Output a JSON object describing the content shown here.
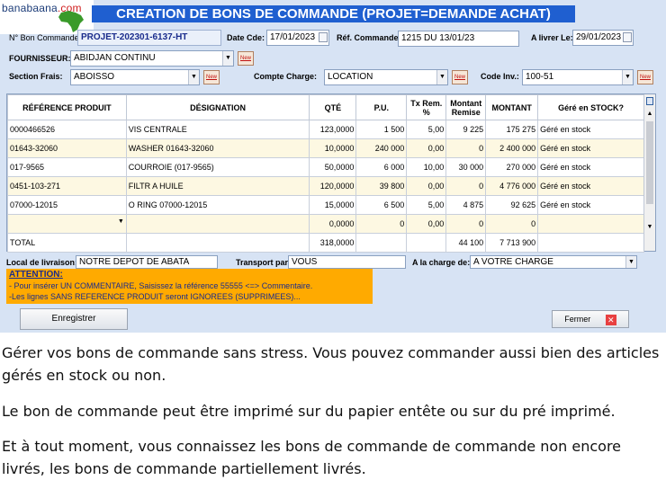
{
  "logo": {
    "text_a": "banabaana",
    "text_b": ".com"
  },
  "title": "CREATION DE BONS DE COMMANDE (PROJET=DEMANDE ACHAT)",
  "header": {
    "num_label": "N° Bon Commande",
    "num_value": "PROJET-202301-6137-HT",
    "date_label": "Date Cde:",
    "date_value": "17/01/2023",
    "ref_label": "Réf. Commande:",
    "ref_value": "1215 DU 13/01/23",
    "livrer_label": "A livrer Le:",
    "livrer_value": "29/01/2023",
    "fournisseur_label": "FOURNISSEUR:",
    "fournisseur_value": "ABIDJAN CONTINU",
    "section_label": "Section Frais:",
    "section_value": "ABOISSO",
    "compte_label": "Compte Charge:",
    "compte_value": "LOCATION",
    "codeinv_label": "Code Inv.:",
    "codeinv_value": "100-51",
    "new_label": "New"
  },
  "table": {
    "columns": [
      "RÉFÉRENCE PRODUIT",
      "DÉSIGNATION",
      "QTÉ",
      "P.U.",
      "Tx Rem. %",
      "Montant Remise",
      "MONTANT",
      "Géré en STOCK?"
    ],
    "rows": [
      [
        "0000466526",
        "VIS CENTRALE",
        "123,0000",
        "1 500",
        "5,00",
        "9 225",
        "175 275",
        "Géré en stock"
      ],
      [
        "01643-32060",
        "WASHER 01643-32060",
        "10,0000",
        "240 000",
        "0,00",
        "0",
        "2 400 000",
        "Géré en stock"
      ],
      [
        "017-9565",
        "COURROIE (017-9565)",
        "50,0000",
        "6 000",
        "10,00",
        "30 000",
        "270 000",
        "Géré en stock"
      ],
      [
        "0451-103-271",
        "FILTR A HUILE",
        "120,0000",
        "39 800",
        "0,00",
        "0",
        "4 776 000",
        "Géré en stock"
      ],
      [
        "07000-12015",
        "O RING 07000-12015",
        "15,0000",
        "6 500",
        "5,00",
        "4 875",
        "92 625",
        "Géré en stock"
      ],
      [
        "",
        "",
        "0,0000",
        "0",
        "0,00",
        "0",
        "0",
        ""
      ]
    ],
    "total": {
      "label": "TOTAL",
      "qte": "318,0000",
      "remise": "44 100",
      "montant": "7 713 900"
    }
  },
  "footer": {
    "livraison_label": "Local de livraison:",
    "livraison_value": "NOTRE DEPOT DE ABATA",
    "transport_label": "Transport par:",
    "transport_value": "VOUS",
    "charge_label": "A  la charge de:",
    "charge_value": "A  VOTRE  CHARGE",
    "warn_title": "ATTENTION:",
    "warn_line1": "- Pour insérer UN COMMENTAIRE, Saisissez la référence 55555 <=> Commentaire.",
    "warn_line2": "-Les lignes SANS REFERENCE PRODUIT seront IGNOREES (SUPPRIMEES)...",
    "save_label": "Enregistrer",
    "close_label": "Fermer"
  },
  "captions": [
    "Gérer vos bons de commande sans stress. Vous pouvez commander aussi bien des articles gérés en stock ou non.",
    "Le bon de commande peut être imprimé sur du papier entête ou sur du pré imprimé.",
    "Et à tout moment, vous connaissez les bons de commande de commande non encore livrés, les bons de commande partiellement livrés."
  ],
  "colors": {
    "title_bg": "#1f5fd0",
    "form_bg": "#d7e3f4",
    "warn_bg": "#ffaa00",
    "row_alt": "#fdf8e2"
  }
}
